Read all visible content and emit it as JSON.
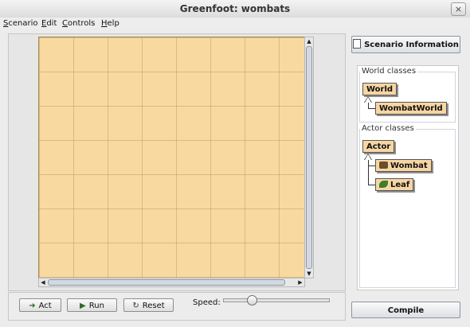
{
  "window": {
    "title": "Greenfoot: wombats",
    "close_glyph": "×"
  },
  "menu": {
    "items": [
      {
        "label": "Scenario",
        "mnemonic": "S"
      },
      {
        "label": "Edit",
        "mnemonic": "E"
      },
      {
        "label": "Controls",
        "mnemonic": "C"
      },
      {
        "label": "Help",
        "mnemonic": "H"
      }
    ]
  },
  "controls": {
    "act_label": "Act",
    "run_label": "Run",
    "reset_label": "Reset",
    "speed_label": "Speed:",
    "speed_fraction": 0.27
  },
  "sidebar": {
    "scenario_info_label": "Scenario Information",
    "world_classes_title": "World classes",
    "world_classes": [
      "World",
      "WombatWorld"
    ],
    "actor_classes_title": "Actor classes",
    "actor_classes": [
      "Actor",
      "Wombat",
      "Leaf"
    ],
    "compile_label": "Compile"
  },
  "colors": {
    "world_background": "#f8d9a0",
    "class_box": "#f7d6a3"
  },
  "icons": {
    "scenario_info": "document-icon",
    "act": "step-arrow-icon",
    "run": "play-icon",
    "reset": "reset-icon",
    "wombat": "wombat-icon",
    "leaf": "leaf-icon"
  }
}
